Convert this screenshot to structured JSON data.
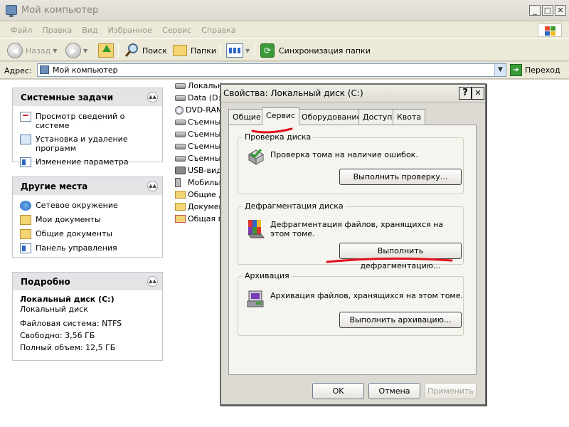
{
  "window": {
    "title": "Мой компьютер",
    "buttons": {
      "minimize": "_",
      "maximize": "□",
      "close": "✕"
    }
  },
  "menu": [
    "Файл",
    "Правка",
    "Вид",
    "Избранное",
    "Сервис",
    "Справка"
  ],
  "toolbar": {
    "back": "Назад",
    "search": "Поиск",
    "folders": "Папки",
    "sync": "Синхронизация папки"
  },
  "address": {
    "label": "Адрес:",
    "value": "Мой компьютер",
    "go": "Переход"
  },
  "sidebar": {
    "system_tasks": {
      "title": "Системные задачи",
      "items": [
        "Просмотр сведений о системе",
        "Установка и удаление программ",
        "Изменение параметра"
      ]
    },
    "other_places": {
      "title": "Другие места",
      "items": [
        "Сетевое окружение",
        "Мои документы",
        "Общие документы",
        "Панель управления"
      ]
    },
    "details": {
      "title": "Подробно",
      "name": "Локальный диск (C:)",
      "type": "Локальный диск",
      "fs": "Файловая система: NTFS",
      "free": "Свободно: 3,56 ГБ",
      "total": "Полный объем: 12,5 ГБ"
    }
  },
  "files": [
    "Локальн",
    "Data (D:)",
    "DVD-RAM",
    "Съемный",
    "Съемный",
    "Съемный",
    "Съемный",
    "USB-виде",
    "Мобильн",
    "Общие д",
    "Докумен",
    "Общая па"
  ],
  "dialog": {
    "title": "Свойства: Локальный диск (C:)",
    "help": "?",
    "close": "✕",
    "tabs": [
      "Общие",
      "Сервис",
      "Оборудование",
      "Доступ",
      "Квота"
    ],
    "check": {
      "title": "Проверка диска",
      "text": "Проверка тома на наличие ошибок.",
      "button": "Выполнить проверку..."
    },
    "defrag": {
      "title": "Дефрагментация диска",
      "text": "Дефрагментация файлов, хранящихся на этом томе.",
      "button": "Выполнить дефрагментацию..."
    },
    "backup": {
      "title": "Архивация",
      "text": "Архивация файлов, хранящихся на этом томе.",
      "button": "Выполнить архивацию..."
    },
    "ok": "OK",
    "cancel": "Отмена",
    "apply": "Применить"
  },
  "colors": {
    "annotation": "#e0101a",
    "xp_red": "#e8492c",
    "xp_green": "#3c9a2c",
    "xp_blue": "#2a67c8",
    "xp_yellow": "#f2b81e"
  }
}
